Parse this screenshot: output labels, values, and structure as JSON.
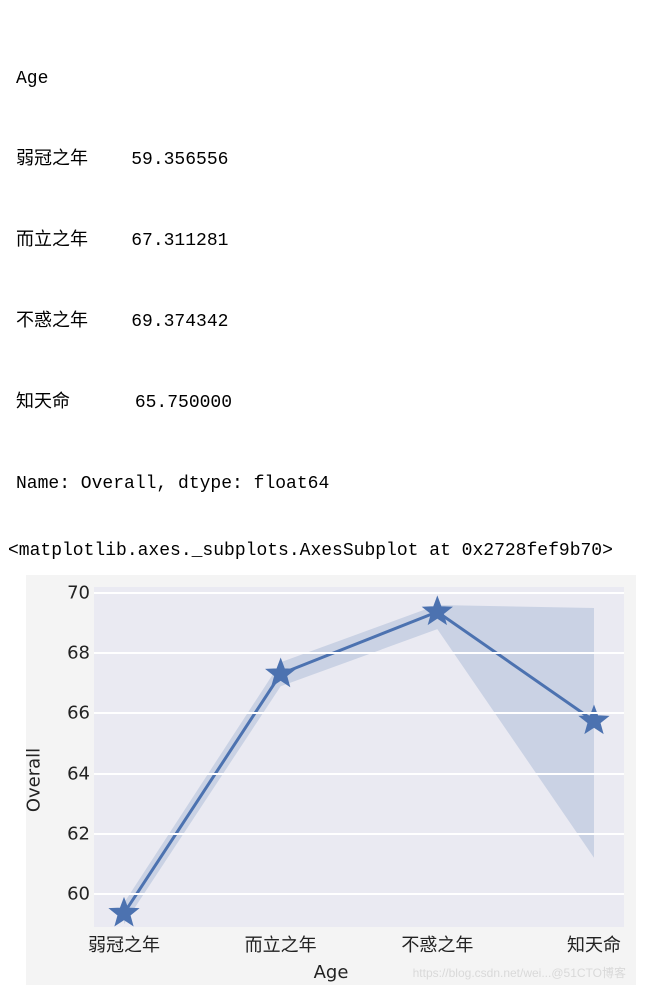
{
  "text_block": {
    "header": "Age",
    "rows": [
      {
        "label": "弱冠之年",
        "value": "59.356556"
      },
      {
        "label": "而立之年",
        "value": "67.311281"
      },
      {
        "label": "不惑之年",
        "value": "69.374342"
      },
      {
        "label": "知天命",
        "value": "65.750000"
      }
    ],
    "footer": "Name: Overall, dtype: float64"
  },
  "repr": "<matplotlib.axes._subplots.AxesSubplot at 0x2728fef9b70>",
  "chart_data": {
    "type": "line",
    "categories": [
      "弱冠之年",
      "而立之年",
      "不惑之年",
      "知天命"
    ],
    "values": [
      59.356556,
      67.311281,
      69.374342,
      65.75
    ],
    "ci_lower": [
      59.0,
      66.9,
      68.8,
      61.2
    ],
    "ci_upper": [
      59.7,
      67.7,
      69.6,
      69.5
    ],
    "xlabel": "Age",
    "ylabel": "Overall",
    "ylim": [
      58.9,
      70.2
    ],
    "yticks": [
      60,
      62,
      64,
      66,
      68,
      70
    ],
    "marker": "star",
    "line_color": "#4c72b0",
    "fill_color": "#8fa7cc"
  },
  "watermark": "https://blog.csdn.net/wei...@51CTO博客"
}
